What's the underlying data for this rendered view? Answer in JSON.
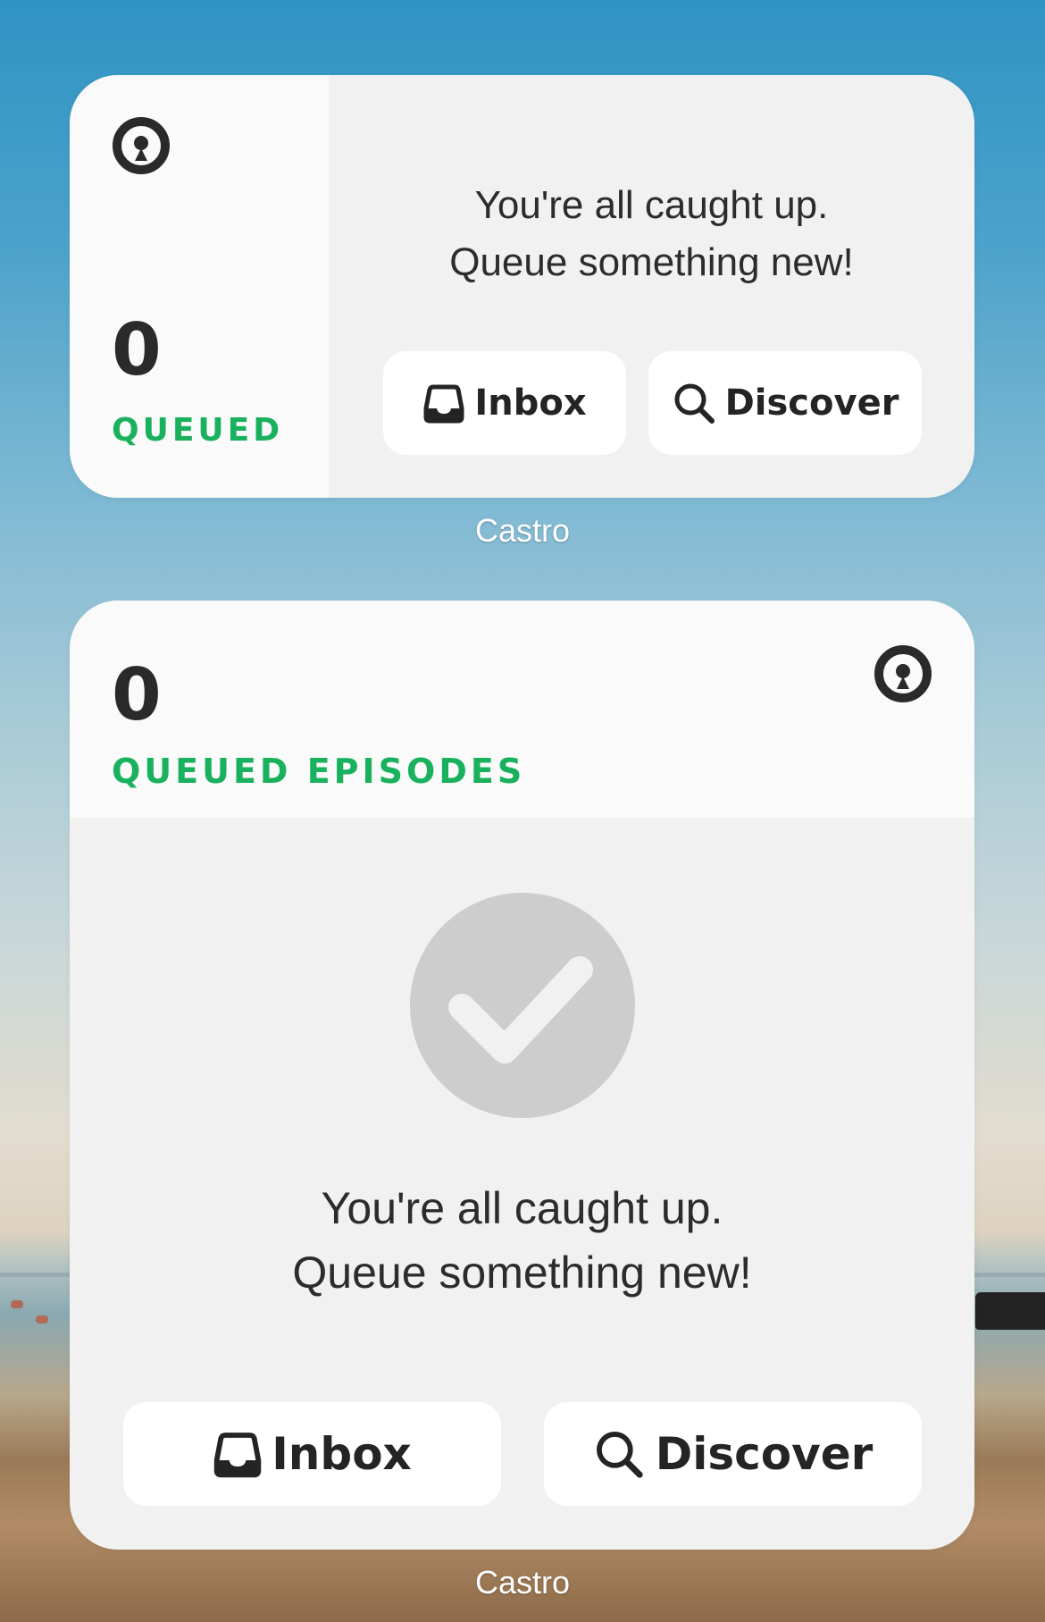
{
  "widget_small": {
    "count": "0",
    "count_label": "QUEUED",
    "message_line1": "You're all caught up.",
    "message_line2": "Queue something new!",
    "inbox_label": "Inbox",
    "discover_label": "Discover"
  },
  "widget_small_app_name": "Castro",
  "widget_large": {
    "count": "0",
    "count_label": "QUEUED EPISODES",
    "message_line1": "You're all caught up.",
    "message_line2": "Queue something new!",
    "inbox_label": "Inbox",
    "discover_label": "Discover"
  },
  "widget_large_app_name": "Castro",
  "icons": {
    "app_icon": "castro-logo-icon",
    "inbox": "inbox-tray-icon",
    "discover": "magnifier-search-icon",
    "done": "checkmark-icon"
  },
  "colors": {
    "accent_green": "#1ab15e",
    "text_dark": "#2a2a2a",
    "check_circle": "#cdcdcd"
  }
}
